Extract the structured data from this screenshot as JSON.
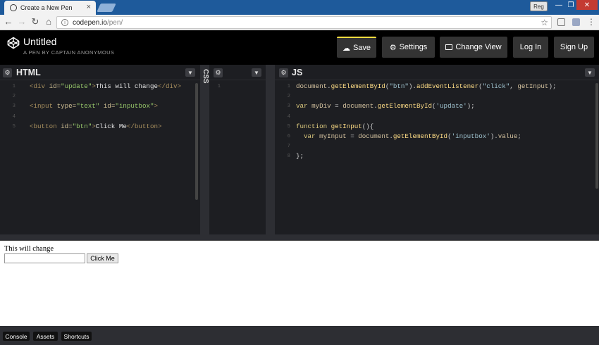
{
  "browser": {
    "tab_title": "Create a New Pen",
    "tab_close": "×",
    "user_badge": "Reg",
    "window_buttons": [
      "—",
      "❐",
      "✕"
    ],
    "url_host": "codepen.io",
    "url_path": "/pen/",
    "nav_icons": [
      "arrow-left",
      "arrow-right",
      "reload",
      "home"
    ]
  },
  "header": {
    "title": "Untitled",
    "subtitle": "A PEN BY CAPTAIN ANONYMOUS",
    "buttons": {
      "save": "Save",
      "settings": "Settings",
      "change_view": "Change View",
      "login": "Log In",
      "signup": "Sign Up"
    },
    "accent_color": "#ffdd40"
  },
  "editors": {
    "html": {
      "title": "HTML",
      "line_numbers": [
        "1",
        "2",
        "3",
        "4",
        "5"
      ]
    },
    "css": {
      "title": "CSS",
      "line_numbers": [
        "1"
      ]
    },
    "js": {
      "title": "JS",
      "line_numbers": [
        "1",
        "2",
        "3",
        "4",
        "5",
        "6",
        "7",
        "8"
      ]
    }
  },
  "preview": {
    "text": "This will change",
    "button_label": "Click Me"
  },
  "footer": {
    "console": "Console",
    "assets": "Assets",
    "shortcuts": "Shortcuts"
  }
}
